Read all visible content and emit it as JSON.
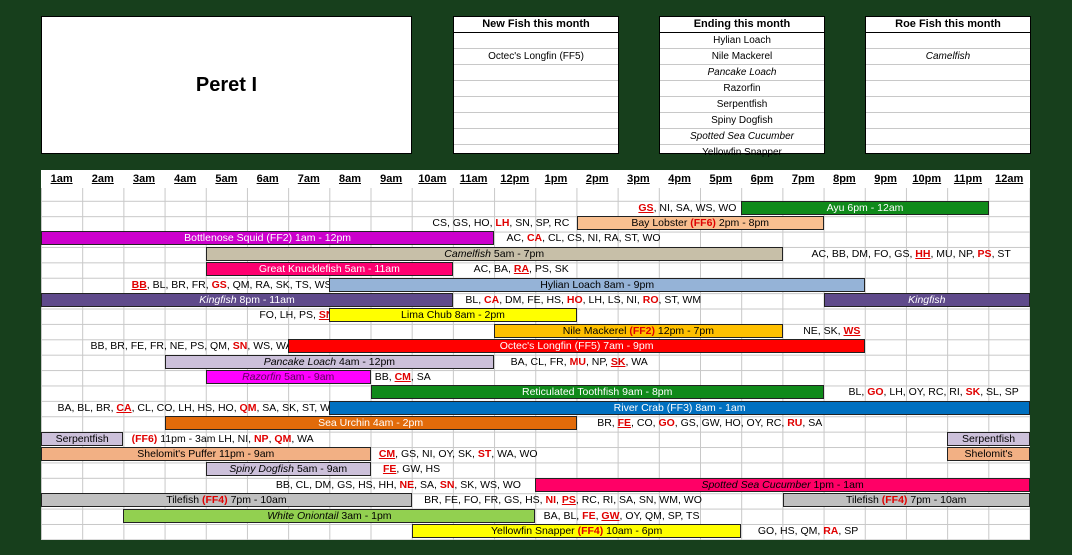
{
  "title": "Peret I",
  "lists": [
    {
      "heading": "New Fish this month",
      "items": [
        {
          "text": ""
        },
        {
          "text": "Octec's Longfin (FF5)"
        }
      ]
    },
    {
      "heading": "Ending this month",
      "items": [
        {
          "text": "Hylian Loach"
        },
        {
          "text": "Nile Mackerel"
        },
        {
          "text": "Pancake Loach",
          "italic": true
        },
        {
          "text": "Razorfin"
        },
        {
          "text": "Serpentfish"
        },
        {
          "text": "Spiny Dogfish"
        },
        {
          "text": "Spotted Sea Cucumber",
          "italic": true
        },
        {
          "text": "Yellowfin Snapper"
        }
      ]
    },
    {
      "heading": "Roe Fish this month",
      "items": [
        {
          "text": ""
        },
        {
          "text": "Camelfish",
          "italic": true
        }
      ]
    }
  ],
  "hours": [
    "1am",
    "2am",
    "3am",
    "4am",
    "5am",
    "6am",
    "7am",
    "8am",
    "9am",
    "10am",
    "11am",
    "12pm",
    "1pm",
    "2pm",
    "3pm",
    "4pm",
    "5pm",
    "6pm",
    "7pm",
    "8pm",
    "9pm",
    "10pm",
    "11pm",
    "12am"
  ],
  "colors": {
    "green": "#0f8a1a",
    "peach": "#f8bf90",
    "magenta": "#cc00cc",
    "tan": "#c7bfa8",
    "pink": "#ff0070",
    "lightblue": "#95b3d7",
    "purple": "#5f4a8b",
    "yellow": "#ffff00",
    "orange": "#ffc000",
    "red": "#ff0000",
    "lavender": "#ccc0da",
    "violet": "#ff00ff",
    "blue": "#0070c0",
    "darkorange": "#e26b0a",
    "gray": "#c0c0c0",
    "hotpink": "#ff0066",
    "lime": "#92d050",
    "wheat": "#f2b084"
  },
  "rows": [
    {
      "segs": [
        {
          "t": "text",
          "h0": 14.5,
          "parts": [
            {
              "s": "GS",
              "c": "ru"
            },
            {
              "s": ", NI, SA, WS, WO"
            }
          ]
        },
        {
          "t": "bar",
          "h0": 17,
          "h1": 23,
          "color": "#0f8a1a",
          "fg": "#fff",
          "parts": [
            {
              "s": "Ayu  6pm - 12am"
            }
          ]
        }
      ]
    },
    {
      "segs": [
        {
          "t": "text",
          "h0": 9.5,
          "parts": [
            {
              "s": "CS, GS, HO, "
            },
            {
              "s": "LH",
              "c": "r"
            },
            {
              "s": ", SN, SP, RC"
            }
          ]
        },
        {
          "t": "bar",
          "h0": 13,
          "h1": 19,
          "color": "#f8bf90",
          "parts": [
            {
              "s": "Bay Lobster "
            },
            {
              "s": "(FF6)",
              "c": "r"
            },
            {
              "s": " 2pm - 8pm"
            }
          ]
        }
      ]
    },
    {
      "segs": [
        {
          "t": "bar",
          "h0": 0,
          "h1": 11,
          "color": "#cc00cc",
          "fg": "#fff",
          "parts": [
            {
              "s": "Bottlenose Squid (FF2)  1am - 12pm"
            }
          ]
        },
        {
          "t": "text",
          "h0": 11.3,
          "parts": [
            {
              "s": "AC, "
            },
            {
              "s": "CA",
              "c": "r"
            },
            {
              "s": ", CL, CS, NI, RA, ST, WO"
            }
          ]
        }
      ]
    },
    {
      "segs": [
        {
          "t": "bar",
          "h0": 4,
          "h1": 18,
          "color": "#c7bfa8",
          "parts": [
            {
              "s": "Camelfish",
              "c": "it"
            },
            {
              "s": "  5am - 7pm"
            }
          ]
        },
        {
          "t": "text",
          "h0": 18.7,
          "parts": [
            {
              "s": "AC, BB, DM, FO, GS, "
            },
            {
              "s": "HH",
              "c": "ru"
            },
            {
              "s": ", MU, NP, "
            },
            {
              "s": "PS",
              "c": "r"
            },
            {
              "s": ", ST"
            }
          ]
        }
      ]
    },
    {
      "segs": [
        {
          "t": "bar",
          "h0": 4,
          "h1": 10,
          "color": "#ff0070",
          "fg": "#fff",
          "parts": [
            {
              "s": "Great Knucklefish  5am - 11am"
            }
          ]
        },
        {
          "t": "text",
          "h0": 10.5,
          "parts": [
            {
              "s": "AC, BA, "
            },
            {
              "s": "RA",
              "c": "ru"
            },
            {
              "s": ", PS, SK"
            }
          ]
        }
      ]
    },
    {
      "segs": [
        {
          "t": "text",
          "h0": 2.2,
          "parts": [
            {
              "s": "BB",
              "c": "ru"
            },
            {
              "s": ", BL, BR, FR, "
            },
            {
              "s": "GS",
              "c": "r"
            },
            {
              "s": ", QM, RA, SK, TS, WS"
            }
          ]
        },
        {
          "t": "bar",
          "h0": 7,
          "h1": 20,
          "color": "#95b3d7",
          "parts": [
            {
              "s": "Hylian Loach  8am - 9pm"
            }
          ]
        }
      ]
    },
    {
      "segs": [
        {
          "t": "bar",
          "h0": 0,
          "h1": 10,
          "color": "#5f4a8b",
          "fg": "#fff",
          "parts": [
            {
              "s": "Kingfish",
              "c": "it"
            },
            {
              "s": "  8pm - 11am"
            }
          ]
        },
        {
          "t": "text",
          "h0": 10.3,
          "parts": [
            {
              "s": "BL, "
            },
            {
              "s": "CA",
              "c": "r"
            },
            {
              "s": ", DM, FE, HS, "
            },
            {
              "s": "HO",
              "c": "r"
            },
            {
              "s": ", LH, LS, NI, "
            },
            {
              "s": "RO",
              "c": "r"
            },
            {
              "s": ", ST, WM"
            }
          ]
        },
        {
          "t": "bar",
          "h0": 19,
          "h1": 24,
          "color": "#5f4a8b",
          "fg": "#fff",
          "parts": [
            {
              "s": "Kingfish",
              "c": "it"
            }
          ]
        }
      ]
    },
    {
      "segs": [
        {
          "t": "text",
          "h0": 5.3,
          "parts": [
            {
              "s": "FO, LH, PS, "
            },
            {
              "s": "SN",
              "c": "ru"
            }
          ]
        },
        {
          "t": "bar",
          "h0": 7,
          "h1": 13,
          "color": "#ffff00",
          "parts": [
            {
              "s": "Lima Chub  8am - 2pm"
            }
          ]
        }
      ]
    },
    {
      "segs": [
        {
          "t": "bar",
          "h0": 11,
          "h1": 18,
          "color": "#ffc000",
          "parts": [
            {
              "s": "Nile Mackerel "
            },
            {
              "s": "(FF2)",
              "c": "r"
            },
            {
              "s": "  12pm - 7pm"
            }
          ]
        },
        {
          "t": "text",
          "h0": 18.5,
          "parts": [
            {
              "s": "NE, SK, "
            },
            {
              "s": "WS",
              "c": "ru"
            }
          ]
        }
      ]
    },
    {
      "segs": [
        {
          "t": "text",
          "h0": 1.2,
          "parts": [
            {
              "s": "BB, BR, FE, FR, NE, PS, QM, "
            },
            {
              "s": "SN",
              "c": "r"
            },
            {
              "s": ", WS, WA"
            }
          ]
        },
        {
          "t": "bar",
          "h0": 6,
          "h1": 20,
          "color": "#ff0000",
          "fg": "#fff",
          "parts": [
            {
              "s": "Octec's Longfin (FF5)  7am - 9pm"
            }
          ]
        }
      ]
    },
    {
      "segs": [
        {
          "t": "bar",
          "h0": 3,
          "h1": 11,
          "color": "#ccc0da",
          "parts": [
            {
              "s": "Pancake Loach",
              "c": "it"
            },
            {
              "s": "  4am - 12pm"
            }
          ]
        },
        {
          "t": "text",
          "h0": 11.4,
          "parts": [
            {
              "s": "BA, CL, FR, "
            },
            {
              "s": "MU",
              "c": "r"
            },
            {
              "s": ", NP, "
            },
            {
              "s": "SK",
              "c": "ru"
            },
            {
              "s": ", WA"
            }
          ]
        }
      ]
    },
    {
      "segs": [
        {
          "t": "bar",
          "h0": 4,
          "h1": 8,
          "color": "#ff00ff",
          "fg": "#5a005a",
          "parts": [
            {
              "s": "Razorfin",
              "c": "it"
            },
            {
              "s": "  5am - 9am"
            }
          ]
        },
        {
          "t": "text",
          "h0": 8.1,
          "parts": [
            {
              "s": "BB, "
            },
            {
              "s": "CM",
              "c": "ru"
            },
            {
              "s": ", SA"
            }
          ]
        }
      ]
    },
    {
      "segs": [
        {
          "t": "bar",
          "h0": 8,
          "h1": 19,
          "color": "#0f8a1a",
          "fg": "#fff",
          "parts": [
            {
              "s": "Reticulated Toothfish  9am - 8pm"
            }
          ]
        },
        {
          "t": "text",
          "h0": 19.6,
          "parts": [
            {
              "s": "BL, "
            },
            {
              "s": "GO",
              "c": "r"
            },
            {
              "s": ", LH, OY, RC, RI, "
            },
            {
              "s": "SK",
              "c": "r"
            },
            {
              "s": ", SL, SP"
            }
          ]
        }
      ]
    },
    {
      "segs": [
        {
          "t": "text",
          "h0": 0.4,
          "parts": [
            {
              "s": "BA, BL, BR, "
            },
            {
              "s": "CA",
              "c": "ru"
            },
            {
              "s": ", CL, CO, LH, HS, HO, "
            },
            {
              "s": "QM",
              "c": "r"
            },
            {
              "s": ", SA, SK, ST, WA"
            }
          ]
        },
        {
          "t": "bar",
          "h0": 7,
          "h1": 24,
          "color": "#0070c0",
          "fg": "#fff",
          "parts": [
            {
              "s": "River Crab (FF3)  8am - 1am"
            }
          ]
        }
      ]
    },
    {
      "segs": [
        {
          "t": "bar",
          "h0": 3,
          "h1": 13,
          "color": "#e26b0a",
          "fg": "#fff",
          "parts": [
            {
              "s": "Sea Urchin  4am - 2pm"
            }
          ]
        },
        {
          "t": "text",
          "h0": 13.5,
          "parts": [
            {
              "s": "BR, "
            },
            {
              "s": "FE",
              "c": "ru"
            },
            {
              "s": ", CO, "
            },
            {
              "s": "GO",
              "c": "r"
            },
            {
              "s": ", GS, GW, HO, OY, RC, "
            },
            {
              "s": "RU",
              "c": "r"
            },
            {
              "s": ", SA"
            }
          ]
        }
      ]
    },
    {
      "segs": [
        {
          "t": "bar",
          "h0": 0,
          "h1": 2,
          "color": "#ccc0da",
          "parts": [
            {
              "s": "Serpentfish"
            }
          ]
        },
        {
          "t": "text",
          "h0": 2.2,
          "parts": [
            {
              "s": "(FF6)",
              "c": "r"
            },
            {
              "s": " 11pm - 3am  LH, NI, "
            },
            {
              "s": "NP",
              "c": "r"
            },
            {
              "s": ", "
            },
            {
              "s": "QM",
              "c": "r"
            },
            {
              "s": ", WA"
            }
          ]
        },
        {
          "t": "bar",
          "h0": 22,
          "h1": 24,
          "color": "#ccc0da",
          "parts": [
            {
              "s": "Serpentfish"
            }
          ]
        }
      ]
    },
    {
      "segs": [
        {
          "t": "bar",
          "h0": 0,
          "h1": 8,
          "color": "#f2b084",
          "parts": [
            {
              "s": "Shelomit's Puffer  11pm - 9am"
            }
          ]
        },
        {
          "t": "text",
          "h0": 8.2,
          "parts": [
            {
              "s": "CM",
              "c": "ru"
            },
            {
              "s": ", GS, NI, OY, SK, "
            },
            {
              "s": "ST",
              "c": "r"
            },
            {
              "s": ", WA, WO"
            }
          ]
        },
        {
          "t": "bar",
          "h0": 22,
          "h1": 24,
          "color": "#f2b084",
          "parts": [
            {
              "s": "Shelomit's"
            }
          ]
        }
      ]
    },
    {
      "segs": [
        {
          "t": "bar",
          "h0": 4,
          "h1": 8,
          "color": "#ccc0da",
          "parts": [
            {
              "s": "Spiny Dogfish",
              "c": "it"
            },
            {
              "s": "  5am - 9am"
            }
          ]
        },
        {
          "t": "text",
          "h0": 8.3,
          "parts": [
            {
              "s": "FE",
              "c": "ru"
            },
            {
              "s": ", GW, HS"
            }
          ]
        }
      ]
    },
    {
      "segs": [
        {
          "t": "text",
          "h0": 5.7,
          "parts": [
            {
              "s": "BB, CL, DM, GS, HS, HH, "
            },
            {
              "s": "NE",
              "c": "r"
            },
            {
              "s": ", SA, "
            },
            {
              "s": "SN",
              "c": "r"
            },
            {
              "s": ", SK, WS, WO"
            }
          ]
        },
        {
          "t": "bar",
          "h0": 12,
          "h1": 24,
          "color": "#ff0066",
          "fg": "#000",
          "parts": [
            {
              "s": "Spotted Sea Cucumber",
              "c": "it"
            },
            {
              "s": "  1pm - 1am"
            }
          ]
        }
      ]
    },
    {
      "segs": [
        {
          "t": "bar",
          "h0": 0,
          "h1": 9,
          "color": "#c0c0c0",
          "parts": [
            {
              "s": "Tilefish "
            },
            {
              "s": "(FF4)",
              "c": "r"
            },
            {
              "s": "  7pm - 10am"
            }
          ]
        },
        {
          "t": "text",
          "h0": 9.3,
          "parts": [
            {
              "s": "BR, FE, FO, FR, GS, HS, "
            },
            {
              "s": "NI",
              "c": "r"
            },
            {
              "s": ", "
            },
            {
              "s": "PS",
              "c": "ru"
            },
            {
              "s": ", RC, RI, SA, SN, WM, WO"
            }
          ]
        },
        {
          "t": "bar",
          "h0": 18,
          "h1": 24,
          "color": "#c0c0c0",
          "parts": [
            {
              "s": "Tilefish "
            },
            {
              "s": "(FF4)",
              "c": "r"
            },
            {
              "s": "  7pm - 10am"
            }
          ]
        }
      ]
    },
    {
      "segs": [
        {
          "t": "bar",
          "h0": 2,
          "h1": 12,
          "color": "#92d050",
          "parts": [
            {
              "s": "White Oniontail",
              "c": "it"
            },
            {
              "s": "  3am - 1pm"
            }
          ]
        },
        {
          "t": "text",
          "h0": 12.2,
          "parts": [
            {
              "s": "BA, BL, "
            },
            {
              "s": "FE",
              "c": "r"
            },
            {
              "s": ", "
            },
            {
              "s": "GW",
              "c": "ru"
            },
            {
              "s": ", OY, QM, SP, TS"
            }
          ]
        }
      ]
    },
    {
      "segs": [
        {
          "t": "bar",
          "h0": 9,
          "h1": 17,
          "color": "#ffff00",
          "parts": [
            {
              "s": "Yellowfin Snapper "
            },
            {
              "s": "(FF4)",
              "c": "r"
            },
            {
              "s": "  10am - 6pm"
            }
          ]
        },
        {
          "t": "text",
          "h0": 17.4,
          "parts": [
            {
              "s": "GO, HS, QM, "
            },
            {
              "s": "RA",
              "c": "r"
            },
            {
              "s": ", SP"
            }
          ]
        }
      ]
    }
  ]
}
